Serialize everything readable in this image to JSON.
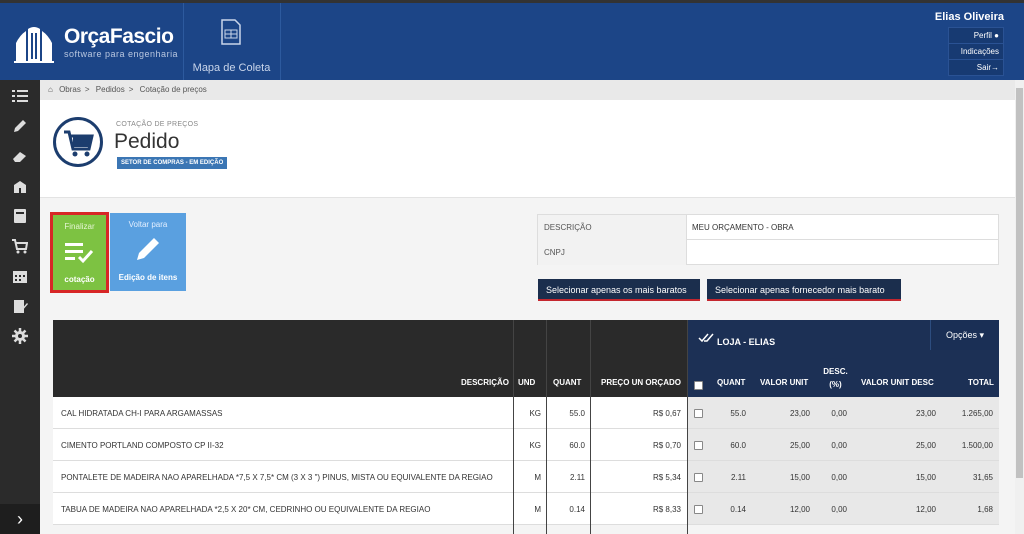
{
  "brand": {
    "name": "OrçaFascio",
    "tagline": "software para engenharia"
  },
  "topnav": {
    "mapa_label": "Mapa de Coleta"
  },
  "user": {
    "name": "Elias Oliveira",
    "menu": [
      "Perfil",
      "Indicações",
      "Sair"
    ]
  },
  "breadcrumb": [
    "Obras",
    "Pedidos",
    "Cotação de preços"
  ],
  "header": {
    "subtitle": "COTAÇÃO DE PREÇOS",
    "title": "Pedido",
    "status": "SETOR DE COMPRAS - EM EDIÇÃO"
  },
  "actions": {
    "finalizar": {
      "top": "Finalizar",
      "bottom": "cotação"
    },
    "voltar": {
      "top": "Voltar para",
      "bottom": "Edição de itens"
    }
  },
  "info": {
    "descricao_label": "DESCRIÇÃO",
    "descricao_value": "MEU ORÇAMENTO - OBRA",
    "cnpj_label": "CNPJ",
    "cnpj_value": ""
  },
  "buttons": {
    "mais_baratos": "Selecionar apenas os mais baratos",
    "fornecedor": "Selecionar apenas fornecedor mais barato"
  },
  "table": {
    "supplier": "LOJA - ELIAS",
    "options": "Opções",
    "headers": {
      "descricao": "DESCRIÇÃO",
      "und": "UND",
      "quant": "QUANT",
      "preco": "PREÇO UN ORÇADO",
      "s_quant": "QUANT",
      "s_valor": "VALOR UNIT",
      "s_desc": "DESC. (%)",
      "s_valor_desc": "VALOR UNIT DESC",
      "s_total": "TOTAL"
    },
    "rows": [
      {
        "descricao": "CAL HIDRATADA CH-I PARA ARGAMASSAS",
        "und": "KG",
        "quant": "55.0",
        "preco": "R$ 0,67",
        "s_quant": "55.0",
        "s_valor": "23,00",
        "s_desc": "0,00",
        "s_valor_desc": "23,00",
        "s_total": "1.265,00"
      },
      {
        "descricao": "CIMENTO PORTLAND COMPOSTO CP II-32",
        "und": "KG",
        "quant": "60.0",
        "preco": "R$ 0,70",
        "s_quant": "60.0",
        "s_valor": "25,00",
        "s_desc": "0,00",
        "s_valor_desc": "25,00",
        "s_total": "1.500,00"
      },
      {
        "descricao": "PONTALETE DE MADEIRA NAO APARELHADA *7,5 X 7,5* CM (3 X 3 \") PINUS, MISTA OU EQUIVALENTE DA REGIAO",
        "und": "M",
        "quant": "2.11",
        "preco": "R$ 5,34",
        "s_quant": "2.11",
        "s_valor": "15,00",
        "s_desc": "0,00",
        "s_valor_desc": "15,00",
        "s_total": "31,65"
      },
      {
        "descricao": "TABUA DE MADEIRA NAO APARELHADA *2,5 X 20* CM, CEDRINHO OU EQUIVALENTE DA REGIAO",
        "und": "M",
        "quant": "0.14",
        "preco": "R$ 8,33",
        "s_quant": "0.14",
        "s_valor": "12,00",
        "s_desc": "0,00",
        "s_valor_desc": "12,00",
        "s_total": "1,68"
      }
    ]
  }
}
